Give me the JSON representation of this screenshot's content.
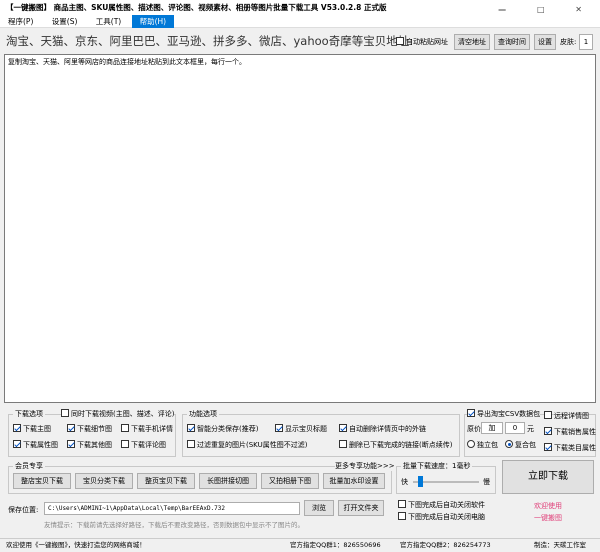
{
  "window": {
    "title": "【一键搬图】 商品主图、SKU属性图、描述图、评论图、视频素材、相册等图片批量下载工具 V53.0.2.8 正式版",
    "controls": "— □ ✕"
  },
  "menu": [
    "程序(P)",
    "设置(S)",
    "工具(T)",
    "帮助(H)"
  ],
  "toolbar": {
    "address_label": "淘宝、天猫、京东、阿里巴巴、亚马逊、拼多多、微店、yahoo奇摩等宝贝地址:",
    "auto_paste": "自动粘贴网址",
    "clear_btn": "清空地址",
    "query_btn": "查询时间",
    "settings_btn": "设置",
    "skin_label": "皮肤:",
    "skin_value": "1"
  },
  "main": {
    "hint": "复制淘宝、天猫、阿里等网店的商品连接地址粘贴到此文本框里，每行一个。"
  },
  "download_options": {
    "title": "下载选项",
    "sync_video": "同时下载视频(主图、描述、评论)",
    "items": [
      {
        "label": "下载主图",
        "checked": true
      },
      {
        "label": "下载细节图",
        "checked": true
      },
      {
        "label": "下载手机详情",
        "checked": false
      },
      {
        "label": "下载属性图",
        "checked": true
      },
      {
        "label": "下载其他图",
        "checked": true
      },
      {
        "label": "下载评论图",
        "checked": false
      }
    ]
  },
  "function_options": {
    "title": "功能选项",
    "items": [
      {
        "label": "智能分类保存(推荐)",
        "checked": true
      },
      {
        "label": "显示宝贝标题",
        "checked": true
      },
      {
        "label": "自动删除详情页中的外链",
        "checked": true
      },
      {
        "label": "过滤重复的图片(SKU属性图不过滤)",
        "checked": false
      },
      {
        "label": "删除已下载完成的链接(断点续传)",
        "checked": false
      }
    ]
  },
  "right_options": {
    "export_csv": "导出淘宝CSV数据包",
    "export_csv_checked": true,
    "remote_detail": "远程详情图",
    "price_label": "原价",
    "price_op": "加",
    "price_value": "0",
    "price_unit": "元",
    "sales_attr": "下载销售属性",
    "radio_single": "独立包",
    "radio_multi": "复合包",
    "category_attr": "下载类目属性"
  },
  "member": {
    "title": "会员专享",
    "more": "更多专享功能>>>",
    "buttons": [
      "整店宝贝下载",
      "宝贝分类下载",
      "整页宝贝下载",
      "长图拼接切图",
      "又拍相册下图",
      "批量加水印设置"
    ]
  },
  "speed": {
    "title": "批量下载速度：",
    "value": "1毫秒",
    "fast": "快",
    "slow": "慢",
    "level": 0.08,
    "close_app": "下图完成后自动关闭软件",
    "shutdown": "下图完成后自动关闭电脑"
  },
  "start": {
    "label": "立即下载",
    "welcome": "欢迎使用",
    "brand": "一键搬图"
  },
  "save": {
    "label": "保存位置:",
    "path": "C:\\Users\\ADMINI~1\\AppData\\Local\\Temp\\BarEEAxD.732",
    "browse": "浏览",
    "open": "打开文件夹",
    "tip": "友情提示：下载前请先选择好路径，下载后不要改变路径，否则数据包中显示不了图片的。"
  },
  "status": {
    "left": "欢迎使用《一键搬图》，快速打造您的网络商城！",
    "qq1": "官方指定QQ群1：826550696",
    "qq2": "官方指定QQ群2：826254773",
    "right": "制造：天碳工作室"
  }
}
